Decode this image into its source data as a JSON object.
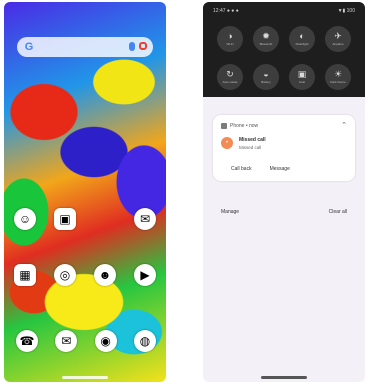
{
  "home": {
    "search_logo": "G",
    "row1": [
      {
        "name": "app-1",
        "glyph": "☺",
        "label": ""
      },
      {
        "name": "app-2",
        "glyph": "▣",
        "label": ""
      },
      {
        "name": "app-3",
        "glyph": "",
        "label": ""
      },
      {
        "name": "app-4",
        "glyph": "✉",
        "label": ""
      }
    ],
    "row2": [
      {
        "name": "app-5",
        "glyph": "▦",
        "label": ""
      },
      {
        "name": "app-6",
        "glyph": "◎",
        "label": ""
      },
      {
        "name": "app-7",
        "glyph": "☻",
        "label": ""
      },
      {
        "name": "app-8",
        "glyph": "▶",
        "label": ""
      }
    ],
    "dock": [
      {
        "name": "phone",
        "glyph": "☎"
      },
      {
        "name": "messages",
        "glyph": "✉"
      },
      {
        "name": "chrome",
        "glyph": "◉"
      },
      {
        "name": "camera",
        "glyph": "◍"
      }
    ]
  },
  "shade": {
    "status_left": "12:47  ● ● ●",
    "status_right": "▼▮ 100",
    "tiles": [
      {
        "glyph": "◑",
        "label": "Wi-Fi"
      },
      {
        "glyph": "✹",
        "label": "Bluetooth"
      },
      {
        "glyph": "◐",
        "label": "Flashlight"
      },
      {
        "glyph": "✈",
        "label": "Airplane"
      },
      {
        "glyph": "↻",
        "label": "Auto-rotate"
      },
      {
        "glyph": "◒",
        "label": "Battery"
      },
      {
        "glyph": "▣",
        "label": "Cast"
      },
      {
        "glyph": "☀",
        "label": "Dark theme"
      }
    ],
    "notification": {
      "app": "Phone • now",
      "avatar": "•",
      "title": "Missed call",
      "text": "Missed call",
      "actions": [
        "Call back",
        "Message"
      ]
    },
    "manage": "Manage",
    "clear_all": "Clear all"
  }
}
